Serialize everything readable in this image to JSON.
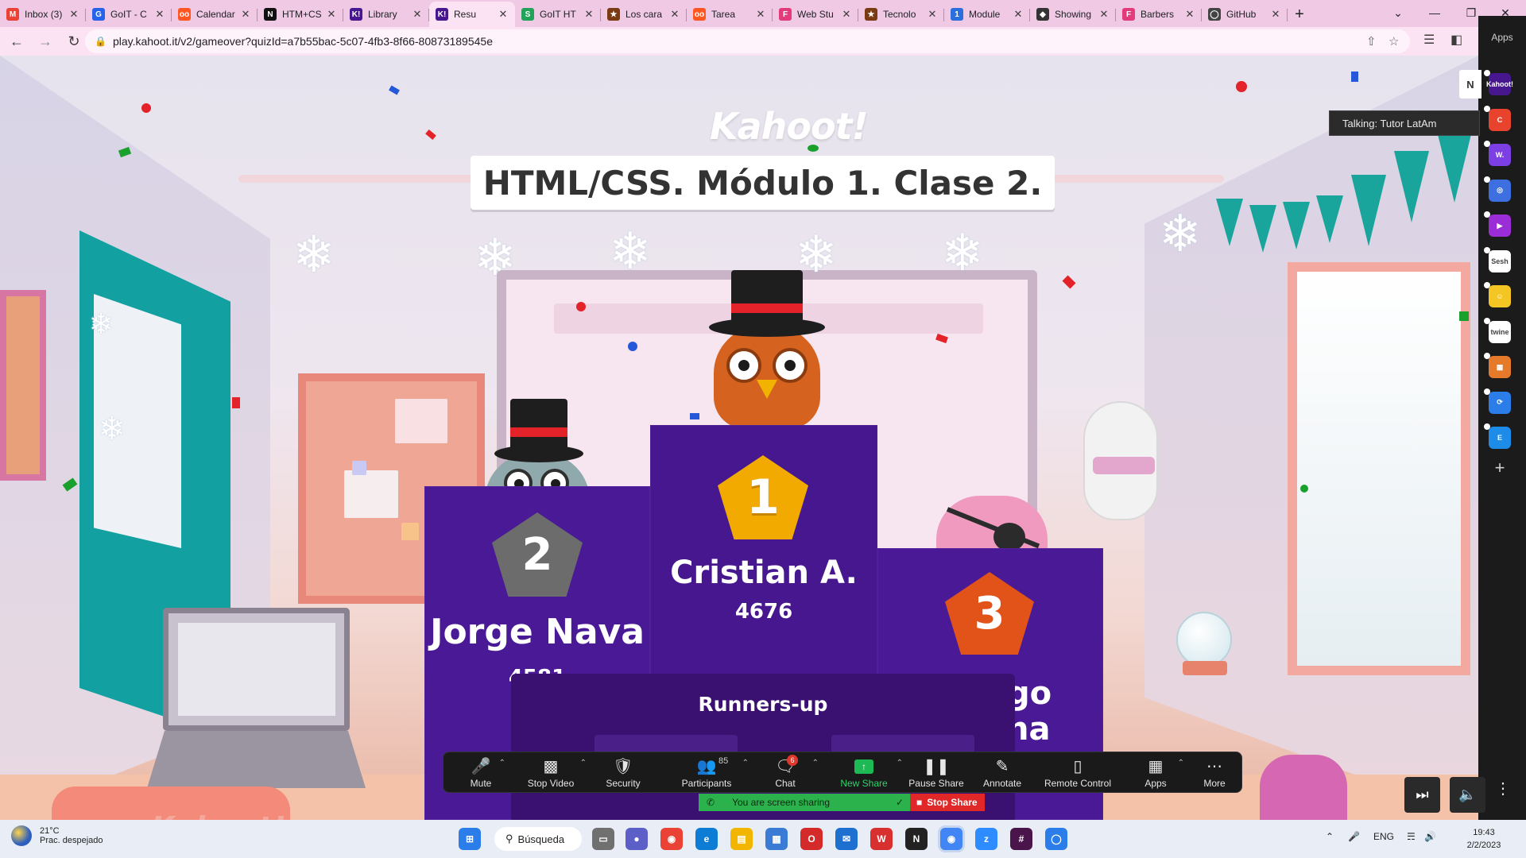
{
  "browser": {
    "tabs": [
      {
        "label": "Inbox (3)",
        "icon": "gmail-icon",
        "color": "#ea4335",
        "glyph": "M"
      },
      {
        "label": "GoIT - C",
        "icon": "goit-icon",
        "color": "#2563eb",
        "glyph": "G"
      },
      {
        "label": "Calendar",
        "icon": "calendar-icon",
        "color": "#ff5722",
        "glyph": "oo"
      },
      {
        "label": "HTM+CS",
        "icon": "notion-icon",
        "color": "#111111",
        "glyph": "N"
      },
      {
        "label": "Library",
        "icon": "kahoot-icon",
        "color": "#46178f",
        "glyph": "K!"
      },
      {
        "label": "Resu",
        "icon": "kahoot-icon",
        "color": "#46178f",
        "glyph": "K!",
        "active": true
      },
      {
        "label": "GoIT HT",
        "icon": "sheets-icon",
        "color": "#22a35a",
        "glyph": "S"
      },
      {
        "label": "Los cara",
        "icon": "star-icon",
        "color": "#7a3a12",
        "glyph": "★"
      },
      {
        "label": "Tarea",
        "icon": "calendar-icon",
        "color": "#ff5722",
        "glyph": "oo"
      },
      {
        "label": "Web Stu",
        "icon": "figma-icon",
        "color": "#e23a7a",
        "glyph": "F"
      },
      {
        "label": "Tecnolo",
        "icon": "star-icon",
        "color": "#7a3a12",
        "glyph": "★"
      },
      {
        "label": "Module",
        "icon": "doc-icon",
        "color": "#2a6fdb",
        "glyph": "1"
      },
      {
        "label": "Showing",
        "icon": "github-icon",
        "color": "#333333",
        "glyph": "◆"
      },
      {
        "label": "Barbers",
        "icon": "figma-icon",
        "color": "#e23a7a",
        "glyph": "F"
      },
      {
        "label": "GitHub",
        "icon": "github-icon",
        "color": "#444444",
        "glyph": "◯"
      }
    ],
    "url": "play.kahoot.it/v2/gameover?quizId=a7b55bac-5c07-4fb3-8f66-80873189545e",
    "apps_label": "Apps"
  },
  "game": {
    "logo": "Kahoot!",
    "quiz_title": "HTML/CSS. Módulo 1. Clase 2.",
    "podium": {
      "first": {
        "rank": "1",
        "name": "Cristian A.",
        "score": "4676"
      },
      "second": {
        "rank": "2",
        "name": "Jorge Nava",
        "score": "4581"
      },
      "third": {
        "rank": "3",
        "name_line1": "ago",
        "name_line2": "na"
      }
    },
    "runners_up_title": "Runners-up",
    "laptop_brand": "Kahoot!"
  },
  "side_panel": {
    "talking": "Talking: Tutor LatAm",
    "n_label": "N",
    "apps": [
      {
        "icon": "kahoot-app-icon",
        "color": "#46178f",
        "glyph": "Kahoot!"
      },
      {
        "icon": "red-app-icon",
        "color": "#e8432d",
        "glyph": "C"
      },
      {
        "icon": "wooclap-icon",
        "color": "#7b3fe4",
        "glyph": "W."
      },
      {
        "icon": "chat-app-icon",
        "color": "#3d6fe0",
        "glyph": "◎"
      },
      {
        "icon": "video-app-icon",
        "color": "#9b2dd6",
        "glyph": "▶"
      },
      {
        "icon": "sesh-icon",
        "color": "#ffffff",
        "glyph": "Sesh"
      },
      {
        "icon": "smile-app-icon",
        "color": "#f3c623",
        "glyph": "☺"
      },
      {
        "icon": "twine-icon",
        "color": "#ffffff",
        "glyph": "twine"
      },
      {
        "icon": "grid-app-icon",
        "color": "#e57a2b",
        "glyph": "▦"
      },
      {
        "icon": "sync-app-icon",
        "color": "#2b7de9",
        "glyph": "⟳"
      },
      {
        "icon": "e-app-icon",
        "color": "#1c8ce8",
        "glyph": "E"
      }
    ]
  },
  "zoom": {
    "mute": "Mute",
    "stop_video": "Stop Video",
    "security": "Security",
    "participants": "Participants",
    "participants_count": "85",
    "chat": "Chat",
    "chat_badge": "6",
    "new_share": "New Share",
    "pause_share": "Pause Share",
    "annotate": "Annotate",
    "remote_control": "Remote Control",
    "apps": "Apps",
    "more": "More",
    "sharing_status": "You are screen sharing",
    "stop_share": "Stop Share"
  },
  "taskbar": {
    "temperature": "21°C",
    "weather": "Prac. despejado",
    "search": "Búsqueda",
    "language": "ENG",
    "time": "19:43",
    "date": "2/2/2023"
  }
}
